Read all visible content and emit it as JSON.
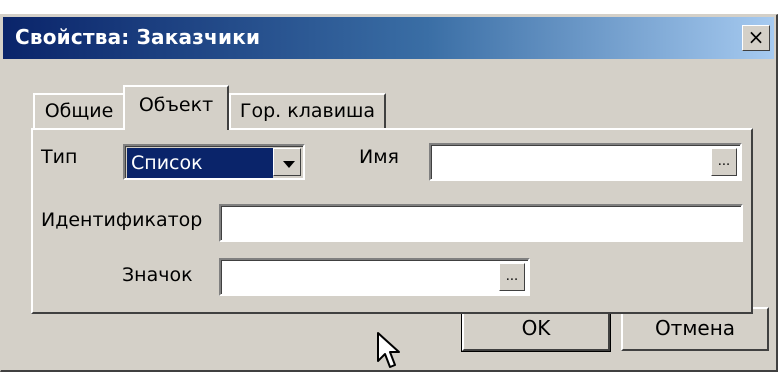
{
  "window": {
    "title": "Свойства: Заказчики",
    "close_glyph": "×"
  },
  "tabs": [
    {
      "label": "Общие",
      "active": false
    },
    {
      "label": "Объект",
      "active": true
    },
    {
      "label": "Гор. клавиша",
      "active": false
    }
  ],
  "form": {
    "type_label": "Тип",
    "type_value": "Список",
    "name_label": "Имя",
    "name_value": "",
    "id_label": "Идентификатор",
    "id_value": "",
    "icon_label": "Значок",
    "icon_value": "",
    "browse_label": "..."
  },
  "buttons": {
    "ok_label": "OK",
    "cancel_label": "Отмена"
  },
  "colors": {
    "titlebar_start": "#0a246a",
    "titlebar_end": "#a6caf0",
    "face": "#d4d0c8",
    "selection": "#0a246a"
  },
  "icons": {
    "close": "close-icon",
    "dropdown": "chevron-down-icon",
    "cursor": "mouse-pointer-icon"
  }
}
